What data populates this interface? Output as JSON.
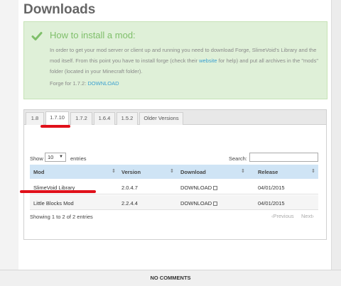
{
  "page": {
    "title": "Downloads"
  },
  "notice": {
    "title": "How to install a mod:",
    "body_before_link": "In order to get your mod server or client up and running you need to download Forge, SlimeVoid's Library and the mod itself. From this point you have to install forge (check their ",
    "body_link": "website",
    "body_after_link": " for help) and put all archives in the \"mods\" folder (located in your Minecraft folder).",
    "forge_label": "Forge for 1.7.2:",
    "forge_link": "DOWNLOAD",
    "icon": "checkmark-icon",
    "accent_color": "#7fbf6a"
  },
  "tabs": [
    {
      "label": "1.8",
      "active": false
    },
    {
      "label": "1.7.10",
      "active": true
    },
    {
      "label": "1.7.2",
      "active": false
    },
    {
      "label": "1.6.4",
      "active": false
    },
    {
      "label": "1.5.2",
      "active": false
    },
    {
      "label": "Older Versions",
      "active": false
    }
  ],
  "table_controls": {
    "show_label": "Show",
    "show_value": "10",
    "entries_label": "entries",
    "search_label": "Search:",
    "search_value": ""
  },
  "table": {
    "columns": [
      "Mod",
      "Version",
      "Download",
      "Release"
    ],
    "rows": [
      {
        "mod": "SlimeVoid Library",
        "version": "2.0.4.7",
        "download": "DOWNLOAD",
        "release": "04/01/2015"
      },
      {
        "mod": "Little Blocks Mod",
        "version": "2.2.4.4",
        "download": "DOWNLOAD",
        "release": "04/01/2015"
      }
    ]
  },
  "footer_info": {
    "showing": "Showing 1 to 2 of 2 entries",
    "previous": "Previous",
    "next": "Next"
  },
  "comments": {
    "label": "NO COMMENTS"
  },
  "colors": {
    "annotation_red": "#e0101a",
    "header_blue": "#cfe4f5",
    "notice_green": "#dff0d8",
    "link_blue": "#3aa0d0"
  }
}
